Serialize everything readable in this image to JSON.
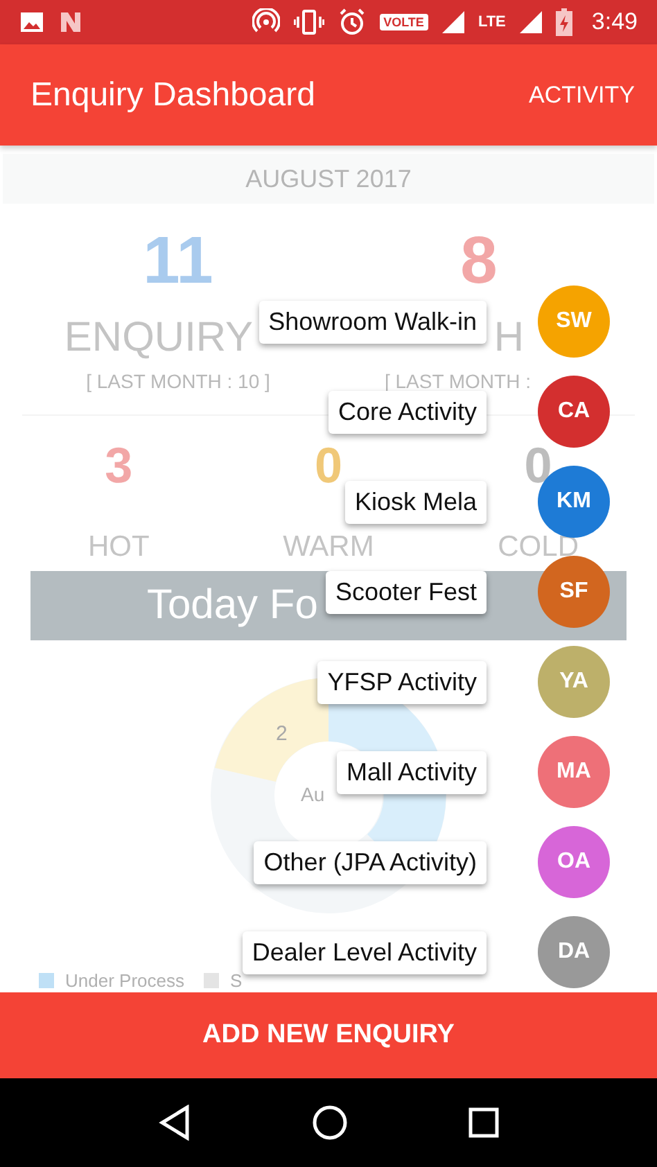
{
  "status_bar": {
    "volte": "VOLTE",
    "network": "LTE",
    "time": "3:49"
  },
  "app_bar": {
    "title": "Enquiry Dashboard",
    "action": "ACTIVITY"
  },
  "month": "AUGUST 2017",
  "summary": [
    {
      "value": "11",
      "label": "ENQUIRY",
      "last_month": "[ LAST MONTH : 10 ]",
      "color": "#a9cbee"
    },
    {
      "value": "8",
      "label": "H",
      "last_month": "[ LAST MONTH :",
      "color": "#f2a7a7"
    }
  ],
  "temperatures": [
    {
      "value": "3",
      "label": "HOT",
      "color": "#f2a7a7"
    },
    {
      "value": "0",
      "label": "WARM",
      "color": "#f0c878"
    },
    {
      "value": "0",
      "label": "COLD",
      "color": "#bdbdbd"
    }
  ],
  "banner": "Today Fo",
  "donut": {
    "center_label": "Au",
    "slice_label": "2"
  },
  "legend": [
    {
      "label": "Under Process",
      "color": "#bfe0f6"
    },
    {
      "label": "S",
      "color": "#e4e4e4"
    }
  ],
  "activity_menu": [
    {
      "label": "Showroom Walk-in",
      "initials": "SW",
      "color": "#f5a300"
    },
    {
      "label": "Core Activity",
      "initials": "CA",
      "color": "#d32f2f"
    },
    {
      "label": "Kiosk Mela",
      "initials": "KM",
      "color": "#1e7bd6"
    },
    {
      "label": "Scooter Fest",
      "initials": "SF",
      "color": "#d2661f"
    },
    {
      "label": "YFSP Activity",
      "initials": "YA",
      "color": "#bdb06a"
    },
    {
      "label": "Mall Activity",
      "initials": "MA",
      "color": "#ee7078"
    },
    {
      "label": "Other (JPA Activity)",
      "initials": "OA",
      "color": "#d766d8"
    },
    {
      "label": "Dealer Level Activity",
      "initials": "DA",
      "color": "#999999"
    }
  ],
  "primary_button": "ADD NEW ENQUIRY"
}
